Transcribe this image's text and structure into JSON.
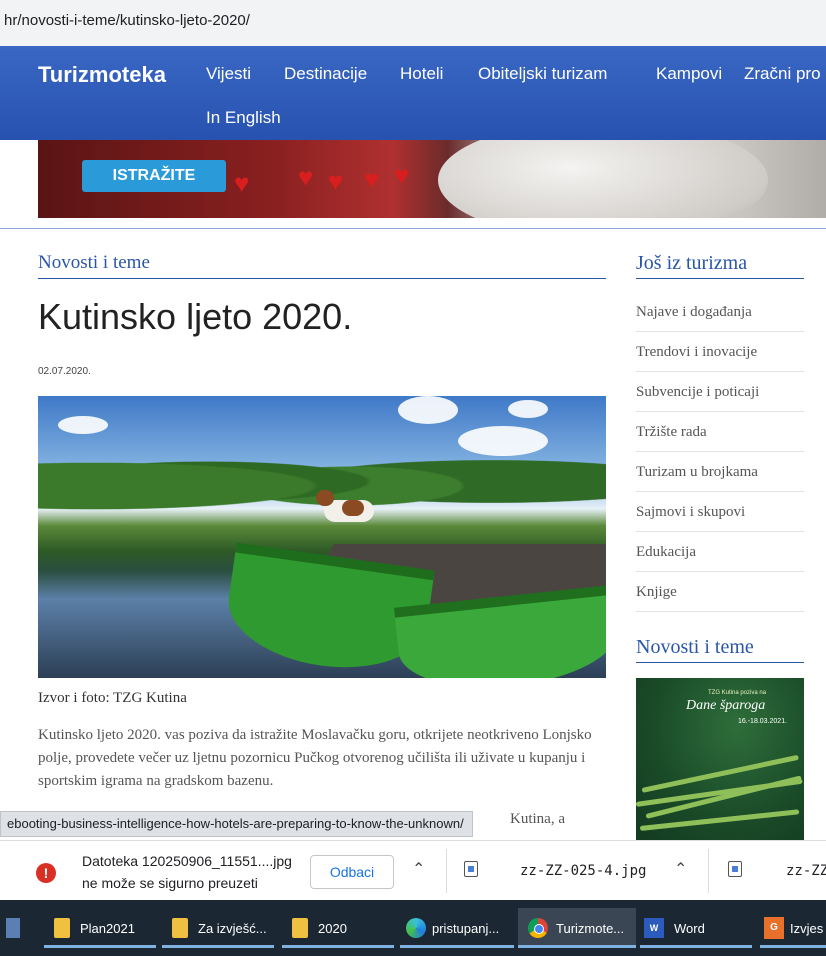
{
  "browser": {
    "url": "hr/novosti-i-teme/kutinsko-ljeto-2020/"
  },
  "nav": {
    "brand": "Turizmoteka",
    "items": [
      "Vijesti",
      "Destinacije",
      "Hoteli",
      "Obiteljski turizam",
      "Kampovi",
      "Zračni pro"
    ],
    "second_row": "In English"
  },
  "banner": {
    "button": "ISTRAŽITE"
  },
  "article": {
    "section": "Novosti i teme",
    "title": "Kutinsko ljeto 2020.",
    "date": "02.07.2020.",
    "caption": "Izvor i foto: TZG Kutina",
    "paragraph": "Kutinsko ljeto 2020. vas poziva da istražite Moslavačku goru, otkrijete neotkriveno Lonjsko polje, provedete večer uz ljetnu pozornicu Pučkog otvorenog učilišta ili uživate u kupanju i sportskim igrama na gradskom bazenu.",
    "paragraph2_visible": "Kutina, a"
  },
  "sidebar": {
    "title": "Još iz turizma",
    "items": [
      "Najave i događanja",
      "Trendovi i inovacije",
      "Subvencije i poticaji",
      "Tržište rada",
      "Turizam u brojkama",
      "Sajmovi i skupovi",
      "Edukacija",
      "Knjige"
    ],
    "title2": "Novosti i teme",
    "thumb": {
      "line1": "TZG Kutina poziva na",
      "line2": "Dane šparoga",
      "line3": "16.-18.03.2021."
    }
  },
  "status_link": "ebooting-business-intelligence-how-hotels-are-preparing-to-know-the-unknown/",
  "downloads": {
    "error_line1": "Datoteka 120250906_11551....jpg",
    "error_line2": "ne može se sigurno preuzeti",
    "discard": "Odbaci",
    "file2": "zz-ZZ-025-4.jpg",
    "file3": "zz-ZZ-"
  },
  "taskbar": {
    "items": [
      "Plan2021",
      "Za izvješć...",
      "2020",
      "pristupanj...",
      "Turizmote...",
      "Word",
      "Izvjes"
    ]
  }
}
